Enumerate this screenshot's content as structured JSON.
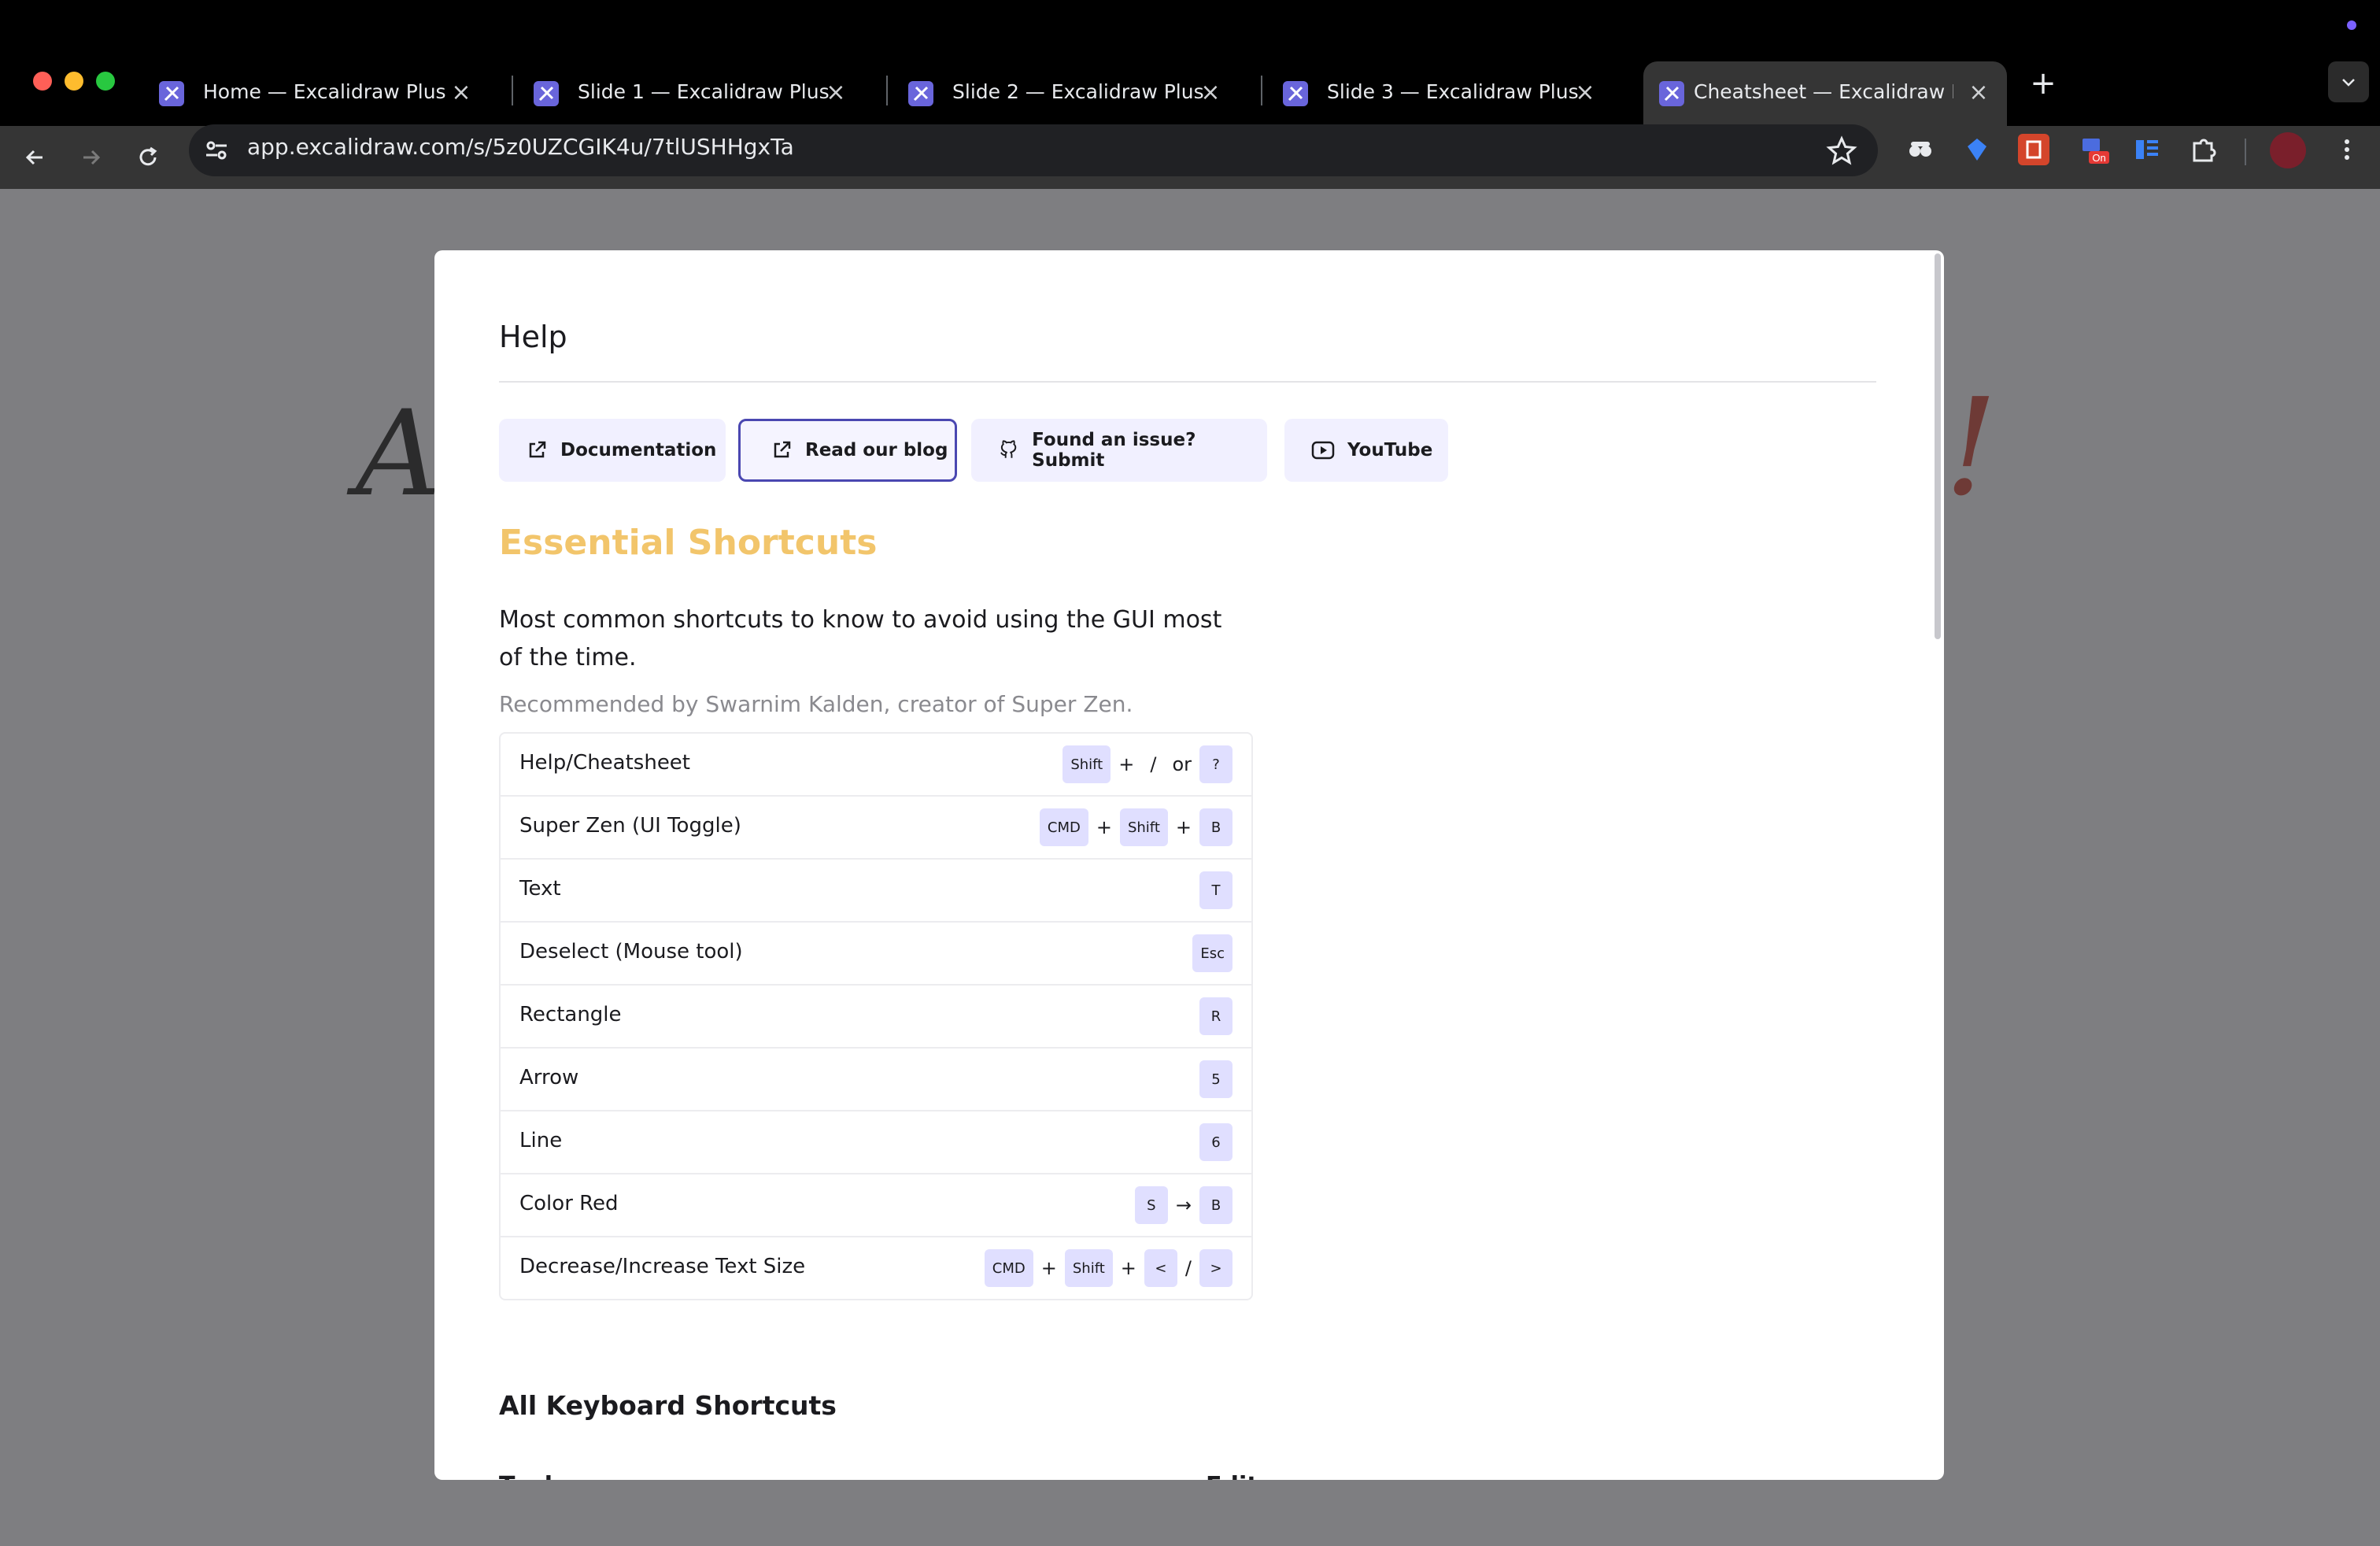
{
  "browser": {
    "tabs": [
      {
        "title": "Home — Excalidraw Plus",
        "active": false
      },
      {
        "title": "Slide 1 — Excalidraw Plus",
        "active": false
      },
      {
        "title": "Slide 2 — Excalidraw Plus",
        "active": false
      },
      {
        "title": "Slide 3 — Excalidraw Plus",
        "active": false
      },
      {
        "title": "Cheatsheet — Excalidraw Plus",
        "active": true
      }
    ],
    "url": "app.excalidraw.com/s/5z0UZCGIK4u/7tlUSHHgxTa",
    "extension_badge": "On",
    "colors": {
      "chrome": "#353535",
      "tabstrip": "#000000",
      "favicon": "#6965db"
    }
  },
  "background": {
    "handwriting_left": "A",
    "handwriting_right": "!"
  },
  "help": {
    "title": "Help",
    "buttons": [
      {
        "label": "Documentation",
        "icon": "external-link-icon"
      },
      {
        "label": "Read our blog",
        "icon": "external-link-icon",
        "focused": true
      },
      {
        "label": "Found an issue? Submit",
        "icon": "github-icon"
      },
      {
        "label": "YouTube",
        "icon": "youtube-icon"
      }
    ],
    "essential": {
      "heading": "Essential Shortcuts",
      "description": "Most common shortcuts to know to avoid using the GUI most of the time.",
      "recommendation": "Recommended by Swarnim Kalden, creator of Super Zen.",
      "rows": [
        {
          "label": "Help/Cheatsheet",
          "keys": [
            "Shift",
            "+",
            "/",
            "or",
            "?"
          ]
        },
        {
          "label": "Super Zen (UI Toggle)",
          "keys": [
            "CMD",
            "+",
            "Shift",
            "+",
            "B"
          ]
        },
        {
          "label": "Text",
          "keys": [
            "T"
          ]
        },
        {
          "label": "Deselect (Mouse tool)",
          "keys": [
            "Esc"
          ]
        },
        {
          "label": "Rectangle",
          "keys": [
            "R"
          ]
        },
        {
          "label": "Arrow",
          "keys": [
            "5"
          ]
        },
        {
          "label": "Line",
          "keys": [
            "6"
          ]
        },
        {
          "label": "Color Red",
          "keys": [
            "S",
            "→",
            "B"
          ]
        },
        {
          "label": "Decrease/Increase Text Size",
          "keys": [
            "CMD",
            "+",
            "Shift",
            "+",
            "<",
            "/",
            ">"
          ]
        }
      ]
    },
    "all_shortcuts_heading": "All Keyboard Shortcuts",
    "tools_heading": "Tools",
    "editor_heading": "Editor",
    "colors": {
      "heading_accent": "#f2c56b",
      "kbd_bg": "#e0dfff",
      "button_bg": "#f1f0ff",
      "focus_ring": "#4a47b1"
    }
  }
}
